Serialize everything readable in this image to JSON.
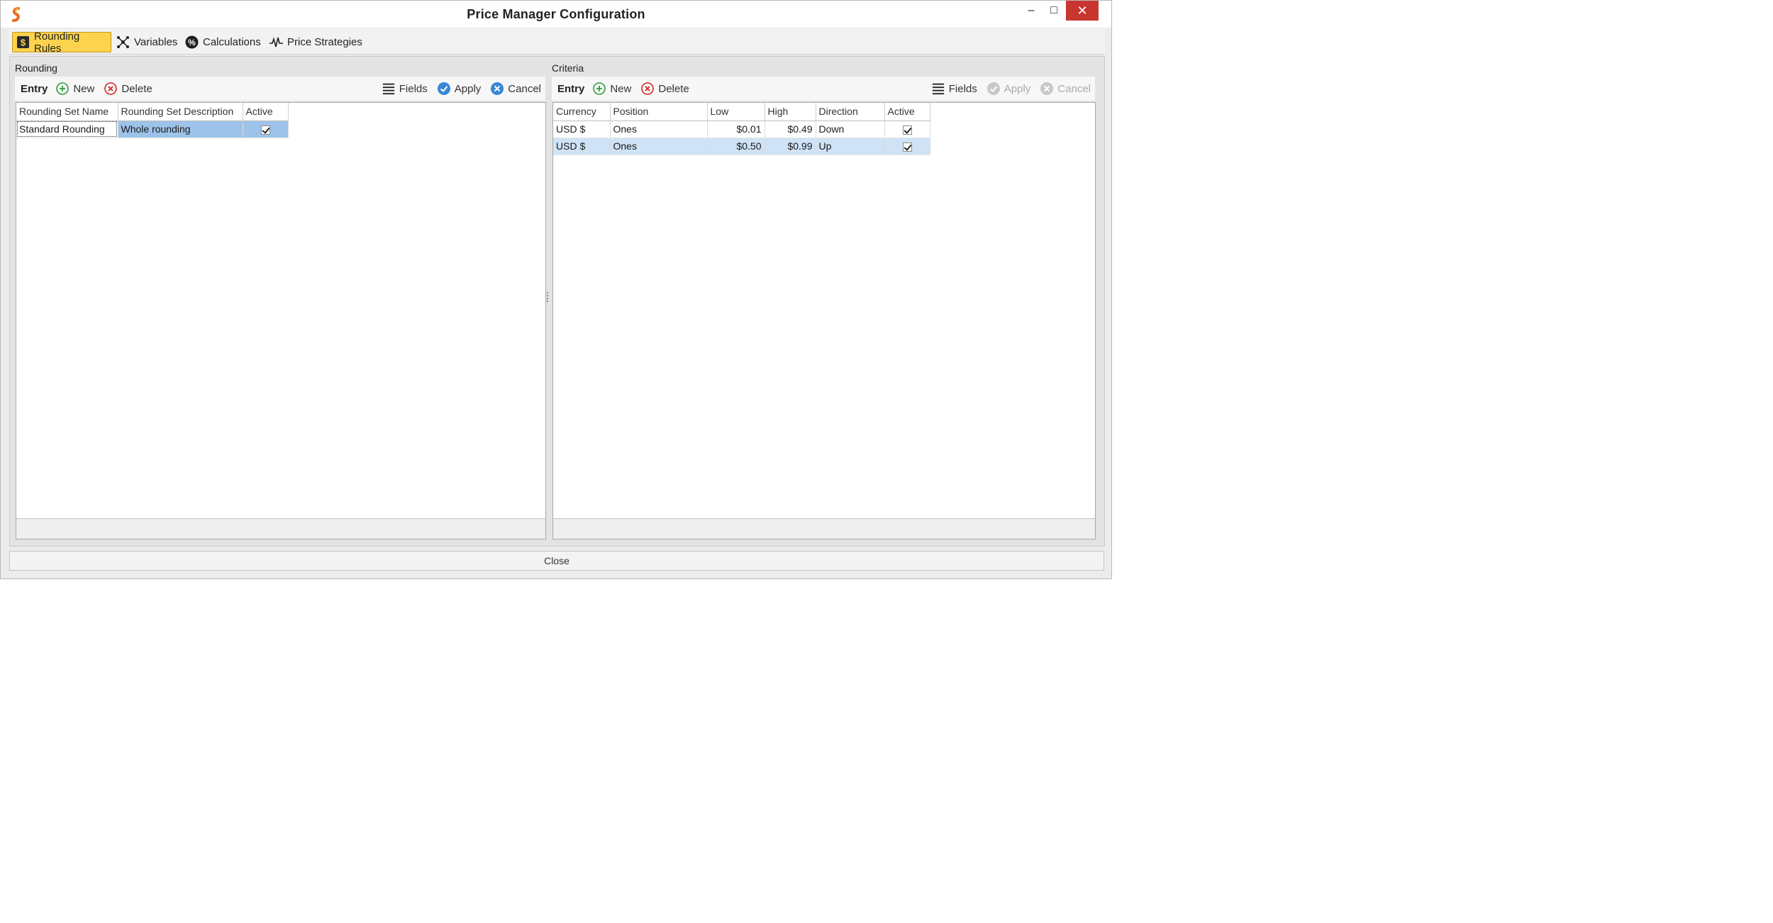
{
  "window": {
    "title": "Price Manager Configuration",
    "controls": {
      "minimize": "‒",
      "maximize": "□",
      "close": "✕"
    }
  },
  "tabs": [
    {
      "label": "Rounding Rules",
      "icon": "dollar-box-icon",
      "active": true
    },
    {
      "label": "Variables",
      "icon": "network-icon",
      "active": false
    },
    {
      "label": "Calculations",
      "icon": "percent-circle-icon",
      "active": false
    },
    {
      "label": "Price Strategies",
      "icon": "pulse-line-icon",
      "active": false
    }
  ],
  "rounding": {
    "title": "Rounding",
    "toolbar": {
      "entry": "Entry",
      "new": "New",
      "delete": "Delete",
      "fields": "Fields",
      "apply": "Apply",
      "cancel": "Cancel"
    },
    "columns": [
      "Rounding Set Name",
      "Rounding Set Description",
      "Active"
    ],
    "rows": [
      {
        "name": "Standard Rounding",
        "description": "Whole rounding",
        "active": true
      }
    ]
  },
  "criteria": {
    "title": "Criteria",
    "toolbar": {
      "entry": "Entry",
      "new": "New",
      "delete": "Delete",
      "fields": "Fields",
      "apply": "Apply",
      "cancel": "Cancel"
    },
    "columns": [
      "Currency",
      "Position",
      "Low",
      "High",
      "Direction",
      "Active"
    ],
    "rows": [
      {
        "currency": "USD $",
        "position": "Ones",
        "low": "$0.01",
        "high": "$0.49",
        "direction": "Down",
        "active": true
      },
      {
        "currency": "USD $",
        "position": "Ones",
        "low": "$0.50",
        "high": "$0.99",
        "direction": "Up",
        "active": true
      }
    ]
  },
  "footer": {
    "close": "Close"
  },
  "colors": {
    "active_tab": "#fbd34d",
    "selection": "#9ec3ea",
    "selection_light": "#cfe2f6",
    "close_button": "#c7372f"
  }
}
